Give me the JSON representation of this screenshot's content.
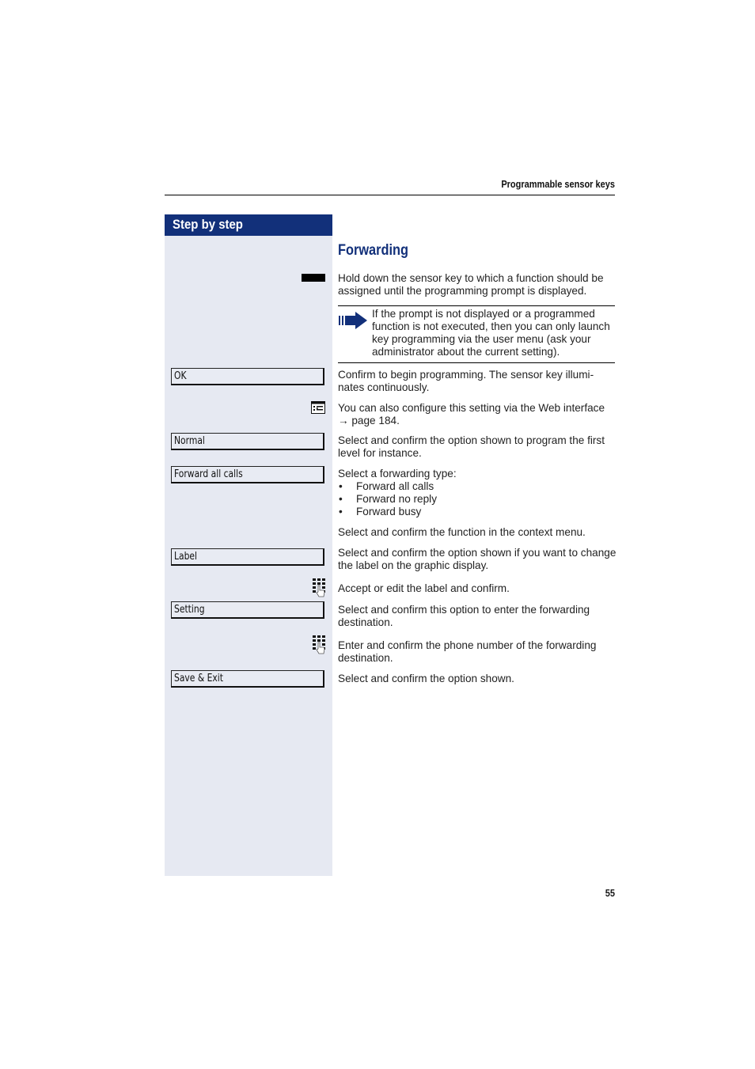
{
  "header": {
    "title": "Programmable sensor keys"
  },
  "sidebar": {
    "title": "Step by step"
  },
  "section": {
    "title": "Forwarding"
  },
  "steps": {
    "sensor_key": {
      "icon": "sensor-key-icon",
      "text": "Hold down the sensor key to which a function should be assigned until the programming prompt is displayed."
    },
    "note": {
      "icon": "note-arrow-icon",
      "text": "If the prompt is not displayed or a programmed function is not executed, then you can only launch key programming via the user menu (ask your administrator about the current setting)."
    },
    "ok": {
      "label": "OK",
      "text": "Confirm to begin programming. The sensor key illumi-nates continuously."
    },
    "web": {
      "icon": "web-interface-icon",
      "text_line1": "You can also configure this setting via the Web interface",
      "arrow": "→",
      "page_ref": "page 184."
    },
    "normal": {
      "label": "Normal",
      "text": "Select and confirm the option shown to program the first level for instance."
    },
    "forward_all": {
      "label": "Forward all calls",
      "intro": "Select a forwarding type:",
      "options": [
        "Forward all calls",
        "Forward no reply",
        "Forward busy"
      ],
      "context": "Select and confirm the function in the context menu."
    },
    "label": {
      "label": "Label",
      "text": "Select and confirm the option shown if you want to change the label on the graphic display."
    },
    "keypad1": {
      "icon": "keypad-icon",
      "text": "Accept or edit the label and confirm."
    },
    "setting": {
      "label": "Setting",
      "text": "Select and confirm this option to enter the forwarding destination."
    },
    "keypad2": {
      "icon": "keypad-icon",
      "text": "Enter and confirm the phone number of the forwarding destination."
    },
    "save_exit": {
      "label": "Save & Exit",
      "text": "Select and confirm the option shown."
    }
  },
  "footer": {
    "page_number": "55"
  },
  "colors": {
    "accent": "#12307a",
    "sidebar_bg": "#e6e9f2"
  }
}
